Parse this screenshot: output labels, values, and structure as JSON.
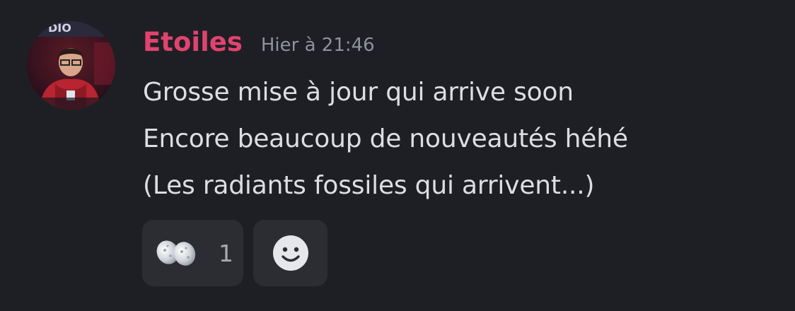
{
  "message": {
    "author": "Etoiles",
    "timestamp": "Hier à 21:46",
    "lines": [
      "Grosse mise à jour qui arrive soon",
      "Encore beaucoup de nouveautés héhé",
      "(Les radiants fossiles qui arrivent...)"
    ],
    "author_color": "#e0436f"
  },
  "reactions": [
    {
      "emoji": "fossil-stones-emoji",
      "count": "1"
    }
  ],
  "add_reaction_icon": "smiley-face-icon"
}
